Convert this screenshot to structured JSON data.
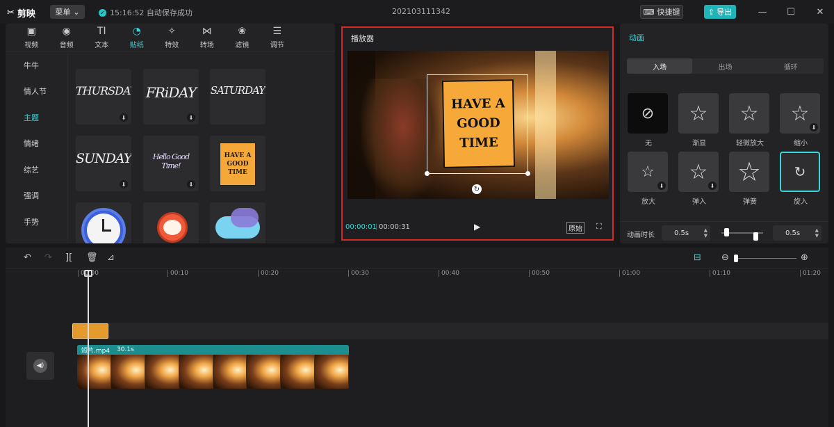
{
  "app": {
    "logo_text": "剪映",
    "menu_label": "菜单",
    "save_status": "15:16:52 自动保存成功",
    "project_name": "202103111342",
    "shortcut_label": "快捷键",
    "export_label": "导出",
    "window_controls": [
      "minimize-icon",
      "maximize-icon",
      "close-icon"
    ]
  },
  "media": {
    "tools": [
      {
        "label": "视频",
        "icon": "video-icon"
      },
      {
        "label": "音频",
        "icon": "audio-icon"
      },
      {
        "label": "文本",
        "icon": "text-icon"
      },
      {
        "label": "贴纸",
        "icon": "sticker-icon",
        "active": true
      },
      {
        "label": "特效",
        "icon": "effects-icon"
      },
      {
        "label": "转场",
        "icon": "transition-icon"
      },
      {
        "label": "滤镜",
        "icon": "filter-icon"
      },
      {
        "label": "调节",
        "icon": "adjust-icon"
      }
    ],
    "categories": [
      "牛牛",
      "情人节",
      "主题",
      "情绪",
      "综艺",
      "强调",
      "手势"
    ],
    "active_category": "主题",
    "stickers": [
      {
        "text": "THURSDAY",
        "downloadable": true
      },
      {
        "text": "FRiDAY",
        "downloadable": true
      },
      {
        "text": "SATURDAY",
        "downloadable": false
      },
      {
        "text": "SUNDAY",
        "downloadable": true
      },
      {
        "text": "Hello Good Time!",
        "downloadable": true
      },
      {
        "text": "HAVE A GOOD TIME",
        "downloadable": false
      },
      {
        "text": "",
        "icon": "clock-icon"
      },
      {
        "text": "",
        "icon": "alarm-clock-icon"
      },
      {
        "text": "",
        "icon": "cloud-icon"
      }
    ]
  },
  "player": {
    "title": "播放器",
    "sticker_text": "HAVE A GOOD TIME",
    "current_time": "00:00:01",
    "total_time": "00:00:31",
    "original_label": "原始"
  },
  "animation": {
    "title": "动画",
    "tabs": [
      "入场",
      "出场",
      "循环"
    ],
    "active_tab": "入场",
    "items": [
      {
        "label": "无",
        "icon": "none-icon"
      },
      {
        "label": "渐显",
        "icon": "star-icon"
      },
      {
        "label": "轻微放大",
        "icon": "star-expand-icon"
      },
      {
        "label": "缩小",
        "icon": "star-icon",
        "downloadable": true
      },
      {
        "label": "放大",
        "icon": "star-expand-icon",
        "downloadable": true
      },
      {
        "label": "弹入",
        "icon": "star-icon",
        "downloadable": true
      },
      {
        "label": "弹簧",
        "icon": "star-icon"
      },
      {
        "label": "旋入",
        "icon": "rotate-star-icon",
        "selected": true
      }
    ],
    "duration_label": "动画时长",
    "duration_in": "0.5s",
    "duration_out": "0.5s"
  },
  "timeline": {
    "ruler_ticks": [
      "00:00",
      "00:10",
      "00:20",
      "00:30",
      "00:40",
      "00:50",
      "01:00",
      "01:10",
      "01:20"
    ],
    "video_clip_name": "短片.mp4",
    "video_clip_duration": "30.1s"
  }
}
